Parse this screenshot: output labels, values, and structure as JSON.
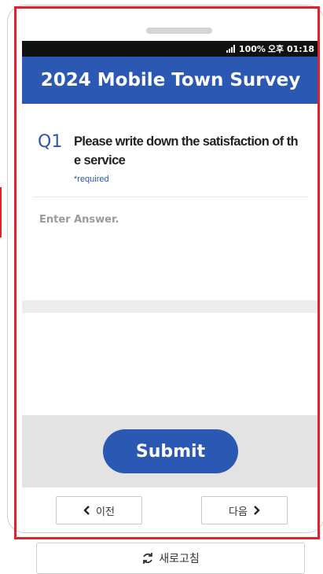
{
  "status_bar": {
    "battery": "100%",
    "time": "오후 01:18"
  },
  "survey": {
    "title": "2024 Mobile Town Survey",
    "question": {
      "number": "Q1",
      "text": "Please write down the satisfaction of the service",
      "required_label": "*required",
      "answer_placeholder": "Enter Answer.",
      "answer_value": ""
    },
    "submit_label": "Submit"
  },
  "navigation": {
    "prev_label": "이전",
    "next_label": "다음"
  },
  "refresh_label": "새로고침",
  "icons": {
    "signal": "signal-icon",
    "prev": "chevron-left-icon",
    "next": "chevron-right-icon",
    "refresh": "refresh-icon"
  },
  "colors": {
    "brand": "#2a58b2",
    "highlight": "#e0222a",
    "status_bar": "#111111"
  }
}
